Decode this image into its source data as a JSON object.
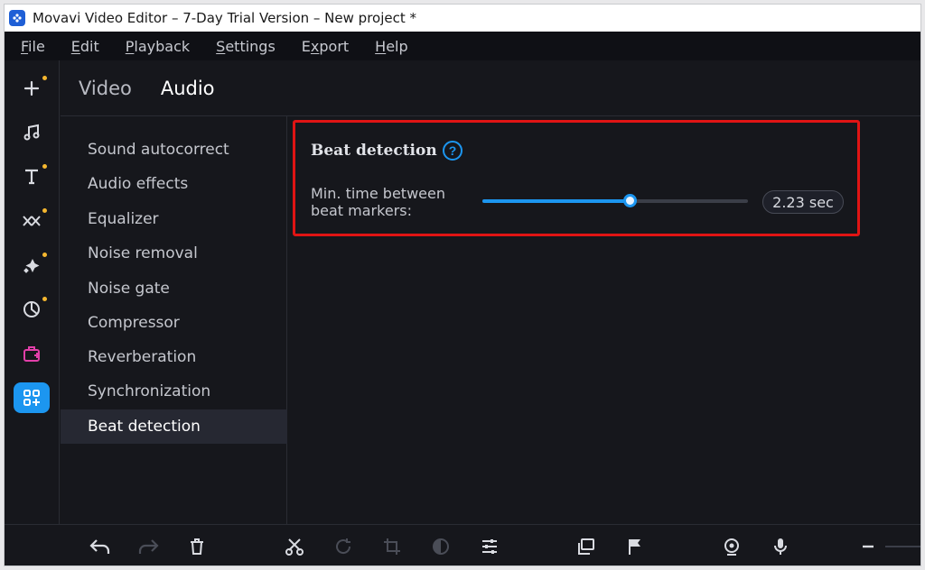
{
  "window": {
    "title": "Movavi Video Editor – 7-Day Trial Version – New project *"
  },
  "menu": [
    {
      "pre": "",
      "u": "F",
      "post": "ile"
    },
    {
      "pre": "",
      "u": "E",
      "post": "dit"
    },
    {
      "pre": "",
      "u": "P",
      "post": "layback"
    },
    {
      "pre": "",
      "u": "S",
      "post": "ettings"
    },
    {
      "pre": "E",
      "u": "x",
      "post": "port"
    },
    {
      "pre": "",
      "u": "H",
      "post": "elp"
    }
  ],
  "tools": [
    {
      "icon": "add-icon",
      "dot": true
    },
    {
      "icon": "music-icon",
      "dot": false
    },
    {
      "icon": "text-icon",
      "dot": true
    },
    {
      "icon": "transitions-icon",
      "dot": true
    },
    {
      "icon": "magic-icon",
      "dot": true
    },
    {
      "icon": "sticker-icon",
      "dot": true
    },
    {
      "icon": "store-icon",
      "dot": false
    },
    {
      "icon": "more-tools-icon",
      "dot": false,
      "active": true
    }
  ],
  "tabs": {
    "video": "Video",
    "audio": "Audio",
    "active": "Audio"
  },
  "categories": {
    "items": [
      "Sound autocorrect",
      "Audio effects",
      "Equalizer",
      "Noise removal",
      "Noise gate",
      "Compressor",
      "Reverberation",
      "Synchronization",
      "Beat detection"
    ],
    "selected": "Beat detection"
  },
  "beat_detection": {
    "title": "Beat detection",
    "help": "?",
    "param_label_line1": "Min. time between",
    "param_label_line2": "beat markers:",
    "slider_fraction": 0.553,
    "value_text": "2.23 sec"
  },
  "bottom_icons": [
    "undo-icon",
    "redo-icon",
    "delete-icon",
    "cut-icon",
    "rotate-icon",
    "crop-icon",
    "color-adjust-icon",
    "settings-sliders-icon",
    "overlay-icon",
    "marker-flag-icon",
    "webcam-icon",
    "microphone-icon",
    "zoom-out-icon"
  ],
  "colors": {
    "accent": "#1c96f0",
    "highlight": "#e01414",
    "dot": "#f5b72f",
    "store": "#e23fa9"
  }
}
